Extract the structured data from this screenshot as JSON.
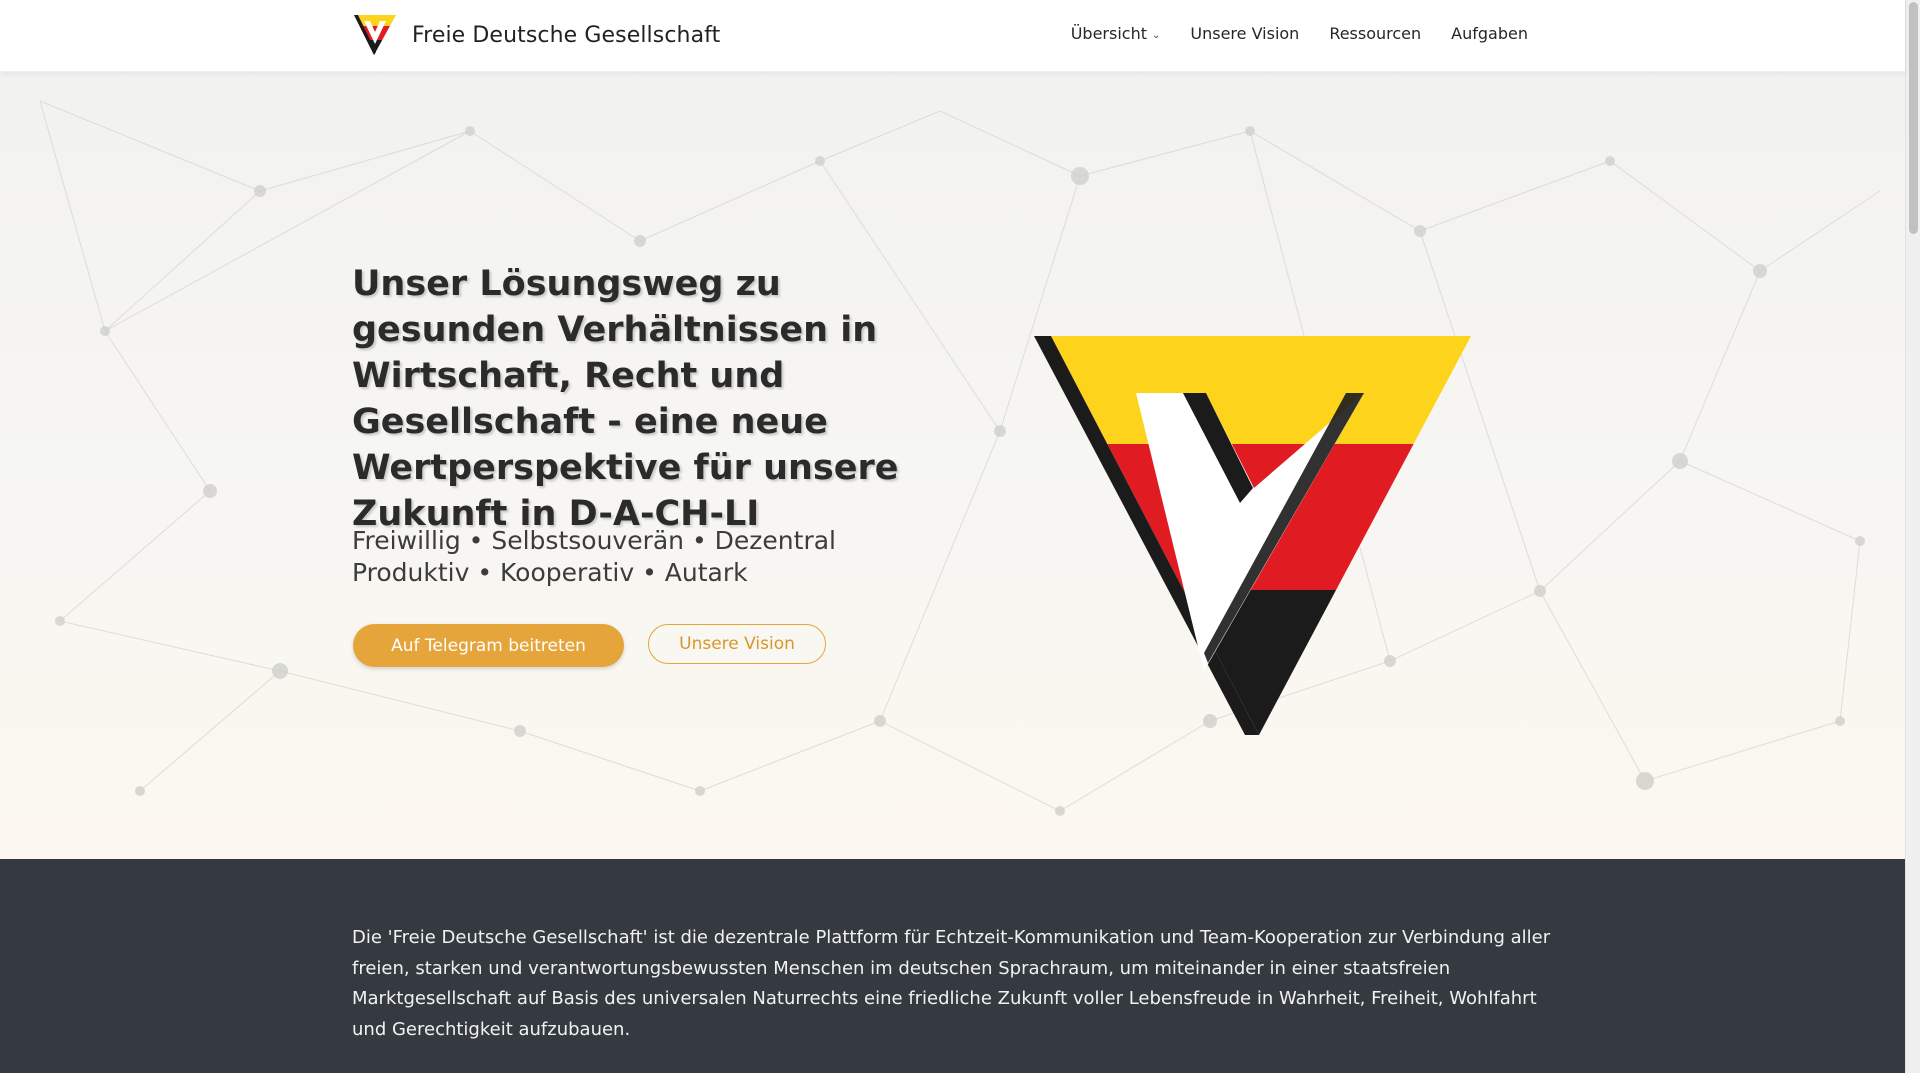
{
  "header": {
    "brand_name": "Freie Deutsche Gesellschaft",
    "logo_icon": "fdg-v-flag-logo",
    "nav": [
      {
        "label": "Übersicht",
        "has_dropdown": true
      },
      {
        "label": "Unsere Vision"
      },
      {
        "label": "Ressourcen"
      },
      {
        "label": "Aufgaben"
      }
    ]
  },
  "hero": {
    "title": "Unser Lösungsweg zu gesunden Verhältnissen in Wirtschaft, Recht und Gesellschaft - eine neue Wertperspektive für unsere Zukunft in D-A-CH-LI",
    "tagline_line1": "Freiwillig • Selbstsouverän • Dezentral",
    "tagline_line2": "Produktiv • Kooperativ • Autark",
    "primary_button": "Auf Telegram beitreten",
    "secondary_button": "Unsere Vision",
    "logo_icon": "fdg-v-flag-logo-large"
  },
  "intro": {
    "text": "Die 'Freie Deutsche Gesellschaft' ist die dezentrale Plattform für Echtzeit-Kommunikation und Team-Kooperation zur Verbindung aller freien, starken und verantwortungsbewussten Menschen im deutschen Sprachraum, um miteinander in einer staatsfreien Marktgesellschaft auf Basis des universalen Naturrechts eine friedliche Zukunft voller Lebensfreude in Wahrheit, Freiheit, Wohlfahrt und Gerechtigkeit aufzubauen."
  },
  "colors": {
    "accent": "#e6a53a",
    "dark_section": "#343a40",
    "flag_black": "#1b1b1b",
    "flag_red": "#e01b22",
    "flag_gold": "#fdd41b"
  }
}
